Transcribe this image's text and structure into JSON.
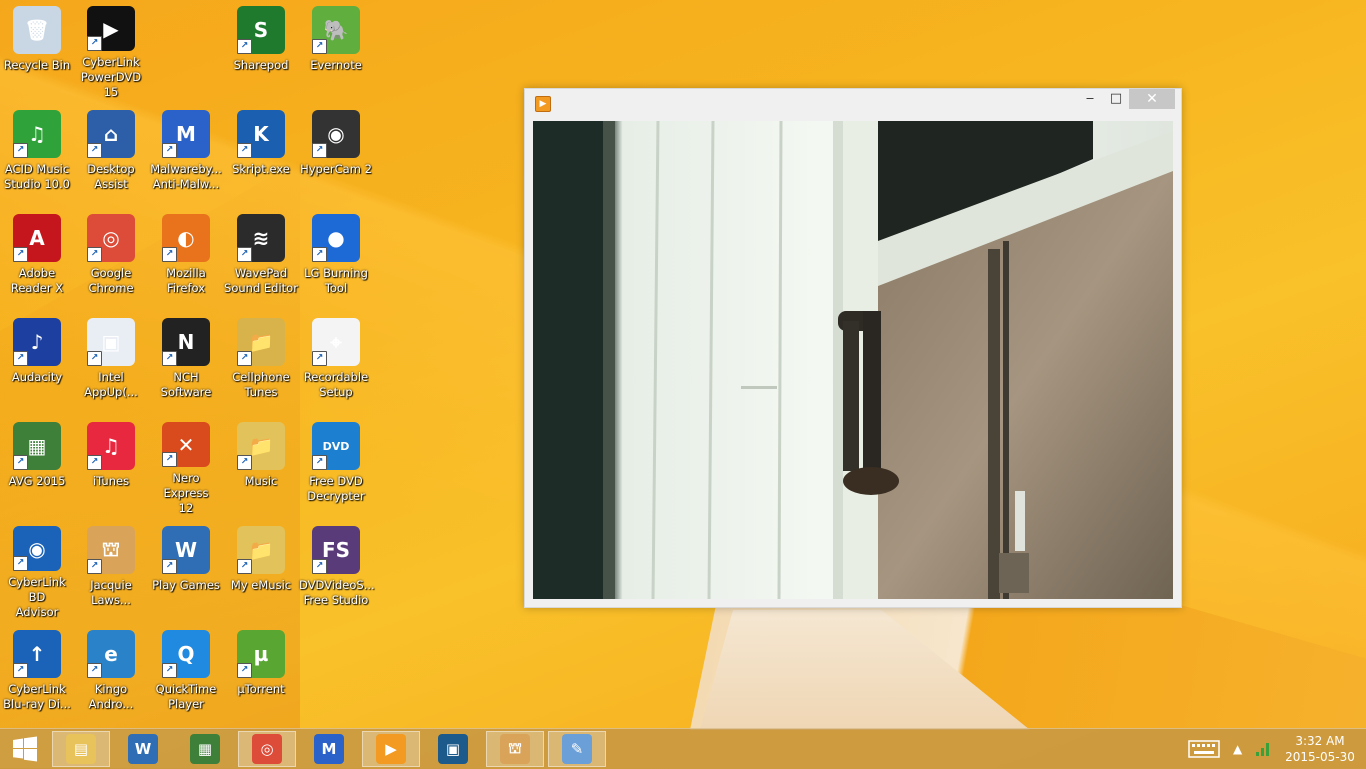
{
  "desktop": {
    "icons": [
      {
        "label": "Recycle Bin",
        "icon": "recycle-bin-icon",
        "color": "#c9d6e3",
        "glyph": "🗑"
      },
      {
        "label": "CyberLink\nPowerDVD 15",
        "icon": "powerdvd-icon",
        "color": "#111111",
        "glyph": "▶"
      },
      {
        "label": "Sharepod",
        "icon": "sharepod-icon",
        "color": "#1f7a2e",
        "glyph": "S"
      },
      {
        "label": "Evernote",
        "icon": "evernote-icon",
        "color": "#5fae3e",
        "glyph": "🐘"
      },
      {
        "label": "ACID Music\nStudio 10.0",
        "icon": "acid-music-icon",
        "color": "#2fa33a",
        "glyph": "♫"
      },
      {
        "label": "Desktop\nAssist",
        "icon": "desktop-assist-icon",
        "color": "#2c5fa8",
        "glyph": "⌂"
      },
      {
        "label": "Malwareby...\nAnti-Malw...",
        "icon": "malwarebytes-icon",
        "color": "#2a62c9",
        "glyph": "M"
      },
      {
        "label": "Skript.exe",
        "icon": "skript-icon",
        "color": "#1b5fb0",
        "glyph": "K"
      },
      {
        "label": "HyperCam 2",
        "icon": "hypercam-icon",
        "color": "#333333",
        "glyph": "◉"
      },
      {
        "label": "Adobe\nReader X",
        "icon": "adobe-reader-icon",
        "color": "#c4161c",
        "glyph": "A"
      },
      {
        "label": "Google\nChrome",
        "icon": "chrome-icon",
        "color": "#dd4b39",
        "glyph": "◎"
      },
      {
        "label": "Mozilla\nFirefox",
        "icon": "firefox-icon",
        "color": "#e8731c",
        "glyph": "◐"
      },
      {
        "label": "WavePad\nSound Editor",
        "icon": "wavepad-icon",
        "color": "#2b2b2b",
        "glyph": "≋"
      },
      {
        "label": "LG Burning\nTool",
        "icon": "lg-burning-icon",
        "color": "#1d6ad6",
        "glyph": "●"
      },
      {
        "label": "Audacity",
        "icon": "audacity-icon",
        "color": "#1d3fa0",
        "glyph": "♪"
      },
      {
        "label": "Intel\nAppUp(...",
        "icon": "intel-appup-icon",
        "color": "#e9eef5",
        "glyph": "▣"
      },
      {
        "label": "NCH\nSoftware",
        "icon": "nch-icon",
        "color": "#222222",
        "glyph": "N"
      },
      {
        "label": "Cellphone\nTunes",
        "icon": "cellphone-tunes-icon",
        "color": "#d8b24a",
        "glyph": "📁"
      },
      {
        "label": "Recordable\nSetup",
        "icon": "recordable-setup-icon",
        "color": "#f4f4f4",
        "glyph": "⌖"
      },
      {
        "label": "AVG 2015",
        "icon": "avg-icon",
        "color": "#3e7f3a",
        "glyph": "▦"
      },
      {
        "label": "iTunes",
        "icon": "itunes-icon",
        "color": "#e8283f",
        "glyph": "♫"
      },
      {
        "label": "Nero Express\n12",
        "icon": "nero-icon",
        "color": "#d94a1d",
        "glyph": "✕"
      },
      {
        "label": "Music",
        "icon": "music-folder-icon",
        "color": "#e2c25a",
        "glyph": "📁"
      },
      {
        "label": "Free DVD\nDecrypter",
        "icon": "dvd-decrypter-icon",
        "color": "#1c7fcf",
        "glyph": "DVD"
      },
      {
        "label": "CyberLink BD\nAdvisor",
        "icon": "bd-advisor-icon",
        "color": "#1a63b8",
        "glyph": "◉"
      },
      {
        "label": "Jacquie\nLaws...",
        "icon": "jacquie-lawson-icon",
        "color": "#d9a35a",
        "glyph": "⛫"
      },
      {
        "label": "Play Games",
        "icon": "play-games-icon",
        "color": "#2f6db5",
        "glyph": "W"
      },
      {
        "label": "My eMusic",
        "icon": "emusic-folder-icon",
        "color": "#e2c25a",
        "glyph": "📁"
      },
      {
        "label": "DVDVideoS...\nFree Studio",
        "icon": "dvdvideosoft-icon",
        "color": "#5a3b7a",
        "glyph": "FS"
      },
      {
        "label": "CyberLink\nBlu-ray Di...",
        "icon": "bluray-disc-icon",
        "color": "#1a63b8",
        "glyph": "↑"
      },
      {
        "label": "Kingo\nAndro...",
        "icon": "kingo-root-icon",
        "color": "#2a83c9",
        "glyph": "e"
      },
      {
        "label": "QuickTime\nPlayer",
        "icon": "quicktime-icon",
        "color": "#1f8ae0",
        "glyph": "Q"
      },
      {
        "label": "µTorrent",
        "icon": "utorrent-icon",
        "color": "#5aa632",
        "glyph": "µ"
      }
    ]
  },
  "window": {
    "app_icon": "media-player-icon",
    "minimize": "‒",
    "maximize": "□",
    "close": "✕"
  },
  "taskbar": {
    "start_icon": "windows-start-icon",
    "apps": [
      {
        "icon": "file-explorer-icon",
        "color": "#e8c25a",
        "glyph": "▤",
        "active": true
      },
      {
        "icon": "play-games-taskbar-icon",
        "color": "#2f6db5",
        "glyph": "W",
        "active": false
      },
      {
        "icon": "avg-taskbar-icon",
        "color": "#3e7f3a",
        "glyph": "▦",
        "active": false
      },
      {
        "icon": "chrome-taskbar-icon",
        "color": "#dd4b39",
        "glyph": "◎",
        "active": true
      },
      {
        "icon": "malwarebytes-taskbar-icon",
        "color": "#2a62c9",
        "glyph": "M",
        "active": false
      },
      {
        "icon": "media-player-taskbar-icon",
        "color": "#f29a21",
        "glyph": "▶",
        "active": true
      },
      {
        "icon": "video-player-taskbar-icon",
        "color": "#1b5a8a",
        "glyph": "▣",
        "active": false
      },
      {
        "icon": "jacquie-lawson-taskbar-icon",
        "color": "#d9a35a",
        "glyph": "⛫",
        "active": true
      },
      {
        "icon": "paint-taskbar-icon",
        "color": "#6a9fd8",
        "glyph": "✎",
        "active": true
      }
    ],
    "tray": {
      "keyboard_icon": "touch-keyboard-icon",
      "chevron_icon": "show-hidden-icons-icon",
      "network_icon": "network-icon"
    },
    "clock": {
      "time": "3:32 AM",
      "date": "2015-05-30"
    }
  }
}
